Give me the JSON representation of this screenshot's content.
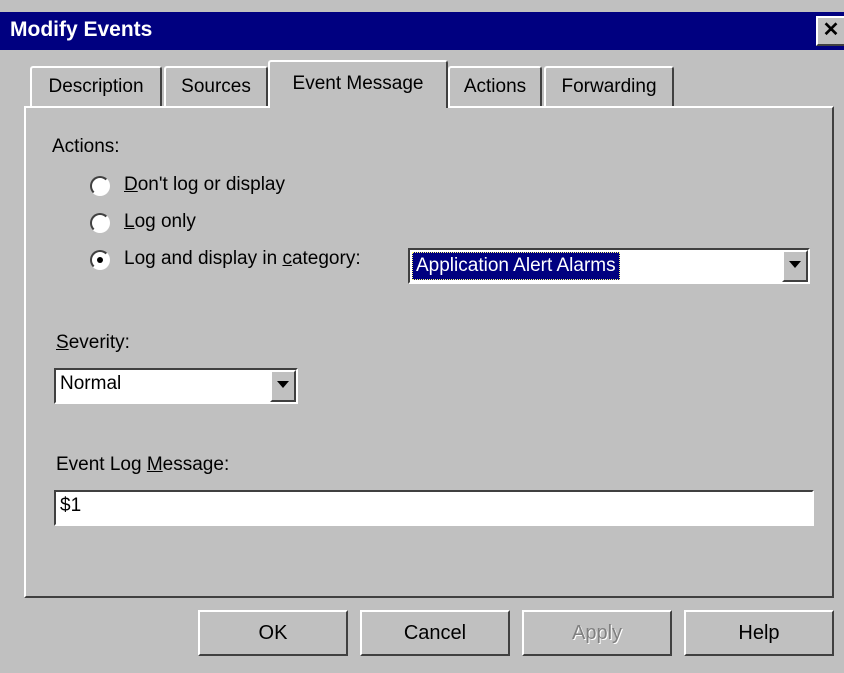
{
  "window": {
    "title": "Modify Events",
    "close_glyph": "✕"
  },
  "tabs": [
    {
      "label": "Description"
    },
    {
      "label": "Sources"
    },
    {
      "label": "Event Message",
      "active": true
    },
    {
      "label": "Actions"
    },
    {
      "label": "Forwarding"
    }
  ],
  "actions": {
    "label": "Actions:",
    "options": [
      {
        "mnemonic": "D",
        "rest": "on't log or display",
        "selected": false
      },
      {
        "mnemonic": "L",
        "rest": "og only",
        "selected": false
      },
      {
        "pre": "Log and display in ",
        "mnemonic": "c",
        "rest": "ategory:",
        "selected": true
      }
    ],
    "category_value": "Application Alert Alarms"
  },
  "severity": {
    "mnemonic": "S",
    "rest": "everity:",
    "value": "Normal"
  },
  "event_log": {
    "pre": "Event Log ",
    "mnemonic": "M",
    "rest": "essage:",
    "value": "$1"
  },
  "buttons": {
    "ok": "OK",
    "cancel": "Cancel",
    "apply": "Apply",
    "help": "Help"
  }
}
